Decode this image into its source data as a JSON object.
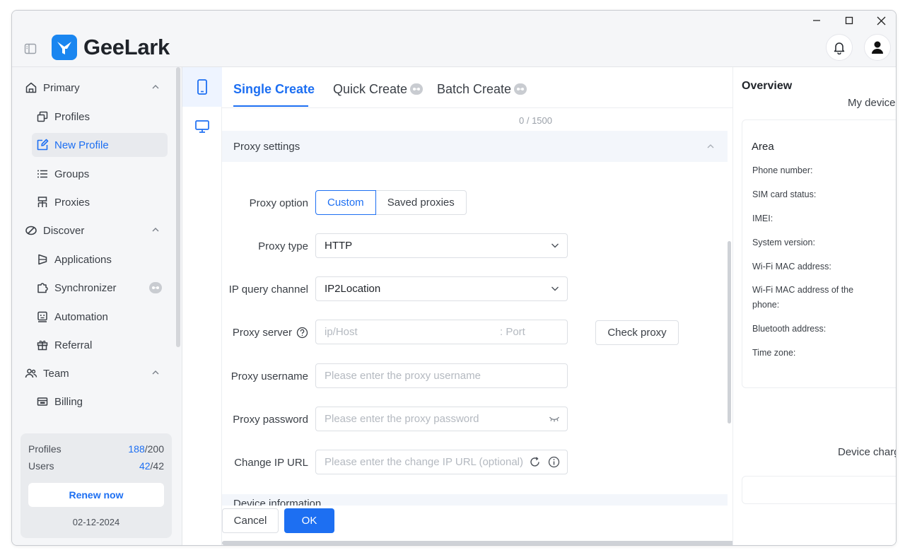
{
  "app": {
    "brand": "GeeLark"
  },
  "sidebar": {
    "groups": [
      {
        "label": "Primary"
      },
      {
        "label": "Discover"
      },
      {
        "label": "Team"
      }
    ],
    "items": [
      {
        "label": "Profiles"
      },
      {
        "label": "New Profile"
      },
      {
        "label": "Groups"
      },
      {
        "label": "Proxies"
      },
      {
        "label": "Applications"
      },
      {
        "label": "Synchronizer"
      },
      {
        "label": "Automation"
      },
      {
        "label": "Referral"
      },
      {
        "label": "Billing"
      }
    ],
    "usage": {
      "profiles_label": "Profiles",
      "profiles_used": "188",
      "profiles_total": "/200",
      "users_label": "Users",
      "users_used": "42",
      "users_total": "/42",
      "renew_label": "Renew now",
      "expiry": "02-12-2024"
    }
  },
  "tabs": [
    {
      "label": "Single Create"
    },
    {
      "label": "Quick Create"
    },
    {
      "label": "Batch Create"
    }
  ],
  "form": {
    "counter": "0 / 1500",
    "proxy_section": "Proxy settings",
    "proxy_option_label": "Proxy option",
    "proxy_option_custom": "Custom",
    "proxy_option_saved": "Saved proxies",
    "proxy_type_label": "Proxy type",
    "proxy_type_value": "HTTP",
    "ip_query_label": "IP query channel",
    "ip_query_value": "IP2Location",
    "proxy_server_label": "Proxy server",
    "proxy_server_host_placeholder": "ip/Host",
    "proxy_server_port_placeholder": ": Port",
    "check_proxy_label": "Check proxy",
    "proxy_username_label": "Proxy username",
    "proxy_username_placeholder": "Please enter the proxy username",
    "proxy_password_label": "Proxy password",
    "proxy_password_placeholder": "Please enter the proxy password",
    "change_ip_label": "Change IP URL",
    "change_ip_placeholder": "Please enter the change IP URL (optional)",
    "device_section": "Device information"
  },
  "actions": {
    "cancel": "Cancel",
    "ok": "OK"
  },
  "overview": {
    "title": "Overview",
    "my_devices": "My devices",
    "area": "Area",
    "props": [
      "Phone number:",
      "SIM card status:",
      "IMEI:",
      "System version:",
      "Wi-Fi MAC address:",
      "Wi-Fi MAC address of the phone:",
      "Bluetooth address:",
      "Time zone:"
    ],
    "device_charge": "Device charg"
  },
  "colors": {
    "accent": "#1d6ff2",
    "logo": "#1a86f0"
  }
}
